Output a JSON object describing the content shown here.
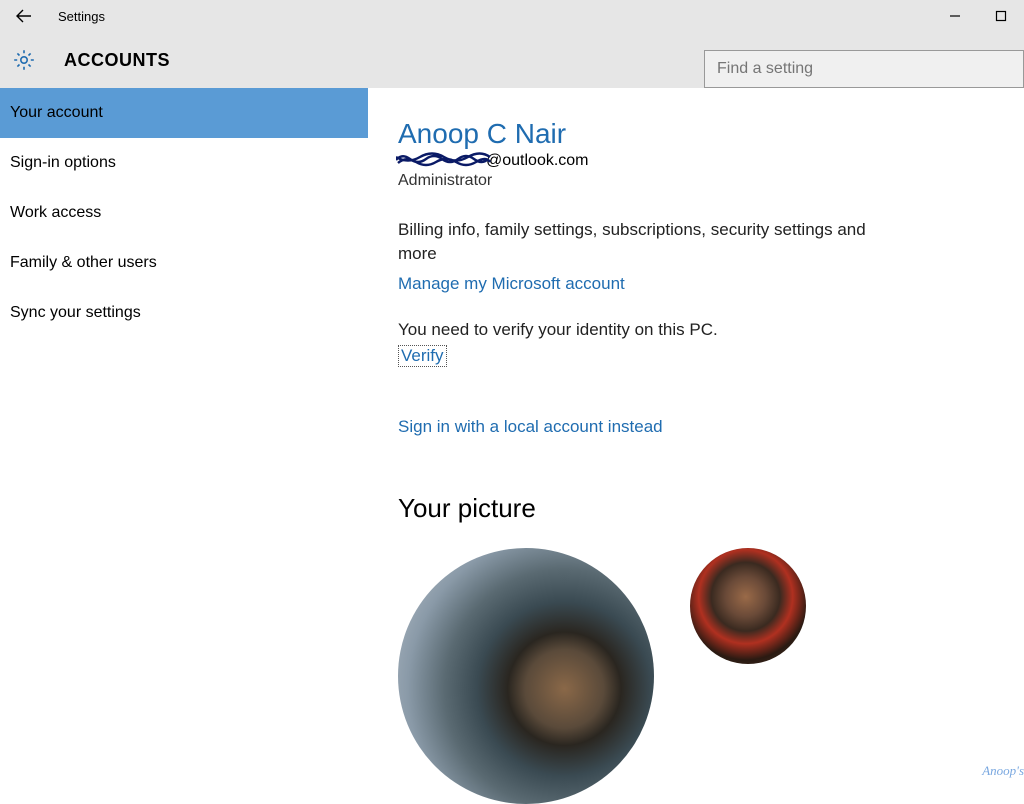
{
  "window": {
    "title": "Settings"
  },
  "header": {
    "section": "ACCOUNTS",
    "search_placeholder": "Find a setting"
  },
  "sidebar": {
    "items": [
      {
        "label": "Your account",
        "active": true
      },
      {
        "label": "Sign-in options",
        "active": false
      },
      {
        "label": "Work access",
        "active": false
      },
      {
        "label": "Family & other users",
        "active": false
      },
      {
        "label": "Sync your settings",
        "active": false
      }
    ]
  },
  "account": {
    "name": "Anoop C Nair",
    "email_visible_suffix": "@outlook.com",
    "role": "Administrator",
    "billing_desc": "Billing info, family settings, subscriptions, security settings and more",
    "manage_link": "Manage my Microsoft account",
    "verify_prompt": "You need to verify your identity on this PC.",
    "verify_link": "Verify",
    "local_account_link": "Sign in with a local account instead",
    "picture_heading": "Your picture"
  },
  "watermark": "Anoop's"
}
